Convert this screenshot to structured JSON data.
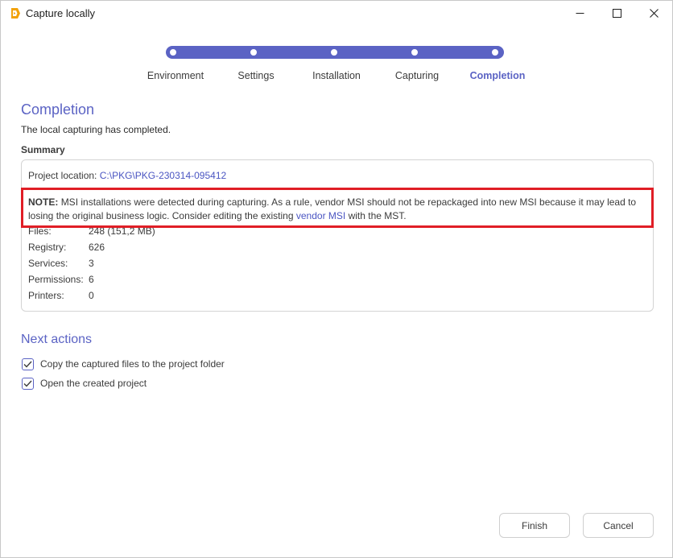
{
  "window": {
    "title": "Capture locally"
  },
  "stepper": {
    "steps": [
      {
        "label": "Environment",
        "active": false
      },
      {
        "label": "Settings",
        "active": false
      },
      {
        "label": "Installation",
        "active": false
      },
      {
        "label": "Capturing",
        "active": false
      },
      {
        "label": "Completion",
        "active": true
      }
    ]
  },
  "completion": {
    "title": "Completion",
    "subtitle": "The local capturing has completed.",
    "summary_label": "Summary",
    "project_location_label": "Project location:",
    "project_location_value": "C:\\PKG\\PKG-230314-095412",
    "note": {
      "prefix": "NOTE:",
      "text_before_link": "MSI installations were detected during capturing. As a rule, vendor MSI should not be repackaged into new MSI because it may lead to losing the original business logic. Consider editing the existing",
      "link_text": "vendor MSI",
      "text_after_link": "with the MST."
    },
    "stats": [
      {
        "label": "Files:",
        "value": "248 (151,2 MB)"
      },
      {
        "label": "Registry:",
        "value": "626"
      },
      {
        "label": "Services:",
        "value": "3"
      },
      {
        "label": "Permissions:",
        "value": "6"
      },
      {
        "label": "Printers:",
        "value": "0"
      }
    ]
  },
  "next_actions": {
    "title": "Next actions",
    "options": [
      {
        "label": "Copy the captured files to the project folder",
        "checked": true
      },
      {
        "label": "Open the created project",
        "checked": true
      }
    ]
  },
  "buttons": {
    "finish": "Finish",
    "cancel": "Cancel"
  },
  "colors": {
    "accent": "#5b63c4",
    "highlight_border": "#e01e26",
    "link": "#4a55c2",
    "app_icon": "#f2a20b"
  },
  "icons": {
    "app": "app-logo-icon",
    "minimize": "minimize-icon",
    "maximize": "maximize-icon",
    "close": "close-icon",
    "check": "checkmark-icon"
  }
}
